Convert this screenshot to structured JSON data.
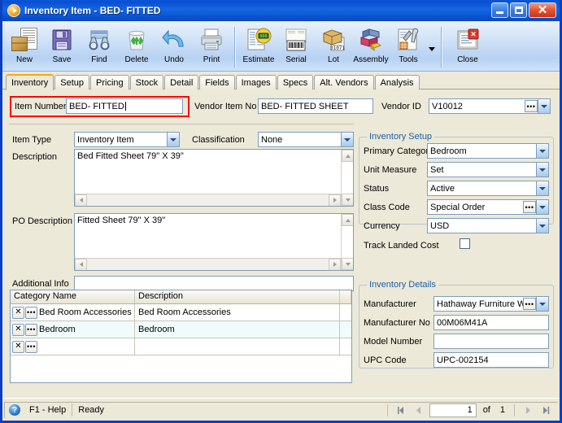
{
  "window": {
    "title_main": "Inventory Item",
    "title_sep": " - ",
    "title_item": "BED- FITTED",
    "app_icon": "play-circle-icon",
    "minimize_label": "Minimize",
    "maximize_label": "Maximize",
    "close_label": "Close"
  },
  "toolbar": {
    "buttons": [
      {
        "label": "New",
        "icon": "new-document-icon"
      },
      {
        "label": "Save",
        "icon": "floppy-disk-icon"
      },
      {
        "label": "Find",
        "icon": "binoculars-icon"
      },
      {
        "label": "Delete",
        "icon": "recycle-bin-icon"
      },
      {
        "label": "Undo",
        "icon": "undo-arrow-icon"
      },
      {
        "label": "Print",
        "icon": "printer-icon"
      },
      {
        "label": "Estimate",
        "icon": "estimate-tag-icon"
      },
      {
        "label": "Serial",
        "icon": "barcode-icon"
      },
      {
        "label": "Lot",
        "icon": "lot-box-icon"
      },
      {
        "label": "Assembly",
        "icon": "assembly-blocks-icon"
      },
      {
        "label": "Tools",
        "icon": "tools-icon"
      },
      {
        "label": "Close",
        "icon": "close-document-icon"
      }
    ],
    "dropdown_arrow": "chevron-down-icon"
  },
  "tabs": [
    {
      "label": "Inventory",
      "active": true
    },
    {
      "label": "Setup",
      "active": false
    },
    {
      "label": "Pricing",
      "active": false
    },
    {
      "label": "Stock",
      "active": false
    },
    {
      "label": "Detail",
      "active": false
    },
    {
      "label": "Fields",
      "active": false
    },
    {
      "label": "Images",
      "active": false
    },
    {
      "label": "Specs",
      "active": false
    },
    {
      "label": "Alt. Vendors",
      "active": false
    },
    {
      "label": "Analysis",
      "active": false
    }
  ],
  "form": {
    "item_number_label": "Item Number",
    "item_number_value": "BED- FITTED",
    "vendor_item_no_label": "Vendor Item No",
    "vendor_item_no_value": "BED- FITTED SHEET",
    "vendor_id_label": "Vendor ID",
    "vendor_id_value": "V10012",
    "item_type_label": "Item Type",
    "item_type_value": "Inventory Item",
    "classification_label": "Classification",
    "classification_value": "None",
    "description_label": "Description",
    "description_value": "Bed Fitted Sheet 79\" X 39\"",
    "po_description_label": "PO Description",
    "po_description_value": "Fitted Sheet 79\" X 39\"",
    "additional_info_label": "Additional Info",
    "additional_info_value": ""
  },
  "inventory_setup": {
    "title": "Inventory Setup",
    "primary_category_label": "Primary Category",
    "primary_category_value": "Bedroom",
    "unit_measure_label": "Unit Measure",
    "unit_measure_value": "Set",
    "status_label": "Status",
    "status_value": "Active",
    "class_code_label": "Class Code",
    "class_code_value": "Special Order",
    "currency_label": "Currency",
    "currency_value": "USD",
    "track_landed_cost_label": "Track Landed Cost",
    "track_landed_cost_checked": false
  },
  "inventory_details": {
    "title": "Inventory Details",
    "manufacturer_label": "Manufacturer",
    "manufacturer_value": "Hathaway Furniture W",
    "manufacturer_no_label": "Manufacturer No",
    "manufacturer_no_value": "00M06M41A",
    "model_number_label": "Model Number",
    "model_number_value": "",
    "upc_code_label": "UPC Code",
    "upc_code_value": "UPC-002154"
  },
  "category_grid": {
    "columns": [
      "Category Name",
      "Description"
    ],
    "rows": [
      {
        "name": "Bed Room Accessories",
        "description": "Bed Room Accessories"
      },
      {
        "name": "Bedroom",
        "description": "Bedroom"
      },
      {
        "name": "",
        "description": ""
      }
    ],
    "delete_button_glyph": "✕",
    "lookup_button_glyph": "…"
  },
  "statusbar": {
    "help_icon": "help-circle-icon",
    "help_text": "F1 - Help",
    "status_text": "Ready",
    "page_current": "1",
    "page_of_label": "of",
    "page_total": "1",
    "first_icon": "first-page-icon",
    "prev_icon": "previous-page-icon",
    "next_icon": "next-page-icon",
    "last_icon": "last-page-icon"
  },
  "colors": {
    "titlebar_blue": "#0a4fd0",
    "window_border": "#0a40c0",
    "face": "#ece9d8",
    "group_title": "#1d5fa8",
    "highlight_red": "#ff0000",
    "tab_active_top": "#f5a623",
    "alt_row": "#f0fcfc"
  }
}
